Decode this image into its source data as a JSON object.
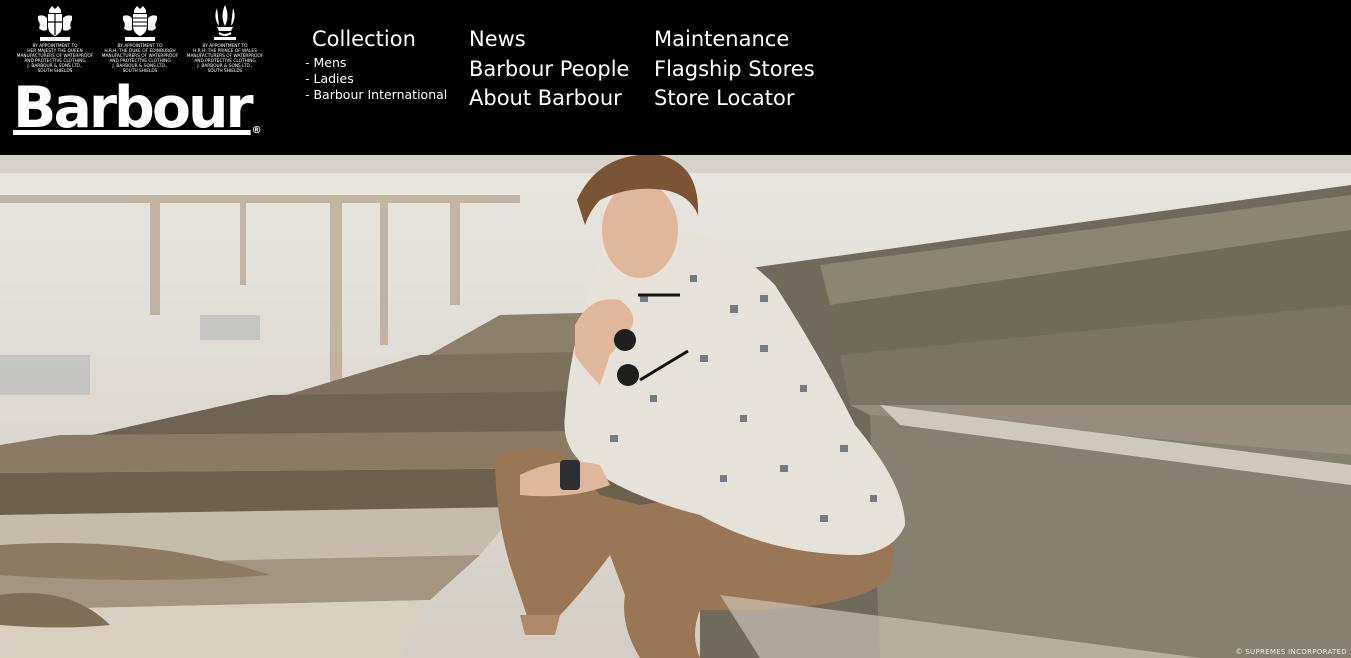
{
  "header": {
    "logo": "Barbour",
    "logo_mark": "®",
    "warrants": [
      {
        "text": "BY APPOINTMENT TO\nHER MAJESTY THE QUEEN\nMANUFACTURERS OF WATERPROOF\nAND PROTECTIVE CLOTHING\nJ. BARBOUR & SONS LTD.,\nSOUTH SHIELDS"
      },
      {
        "text": "BY APPOINTMENT TO\nH.R.H. THE DUKE OF EDINBURGH\nMANUFACTURERS OF WATERPROOF\nAND PROTECTIVE CLOTHING\nJ. BARBOUR & SONS LTD.,\nSOUTH SHIELDS"
      },
      {
        "text": "BY APPOINTMENT TO\nH.R.H. THE PRINCE OF WALES\nMANUFACTURERS OF WATERPROOF\nAND PROTECTIVE CLOTHING\nJ. BARBOUR & SONS LTD.,\nSOUTH SHIELDS"
      }
    ]
  },
  "nav": {
    "collection": {
      "label": "Collection",
      "items": [
        "- Mens",
        "- Ladies",
        "- Barbour International"
      ]
    },
    "col2": [
      "News",
      "Barbour People",
      "About Barbour"
    ],
    "col3": [
      "Maintenance",
      "Flagship Stores",
      "Store Locator"
    ]
  },
  "hero": {
    "credit": "© SUPREMES INCORPORATED"
  }
}
